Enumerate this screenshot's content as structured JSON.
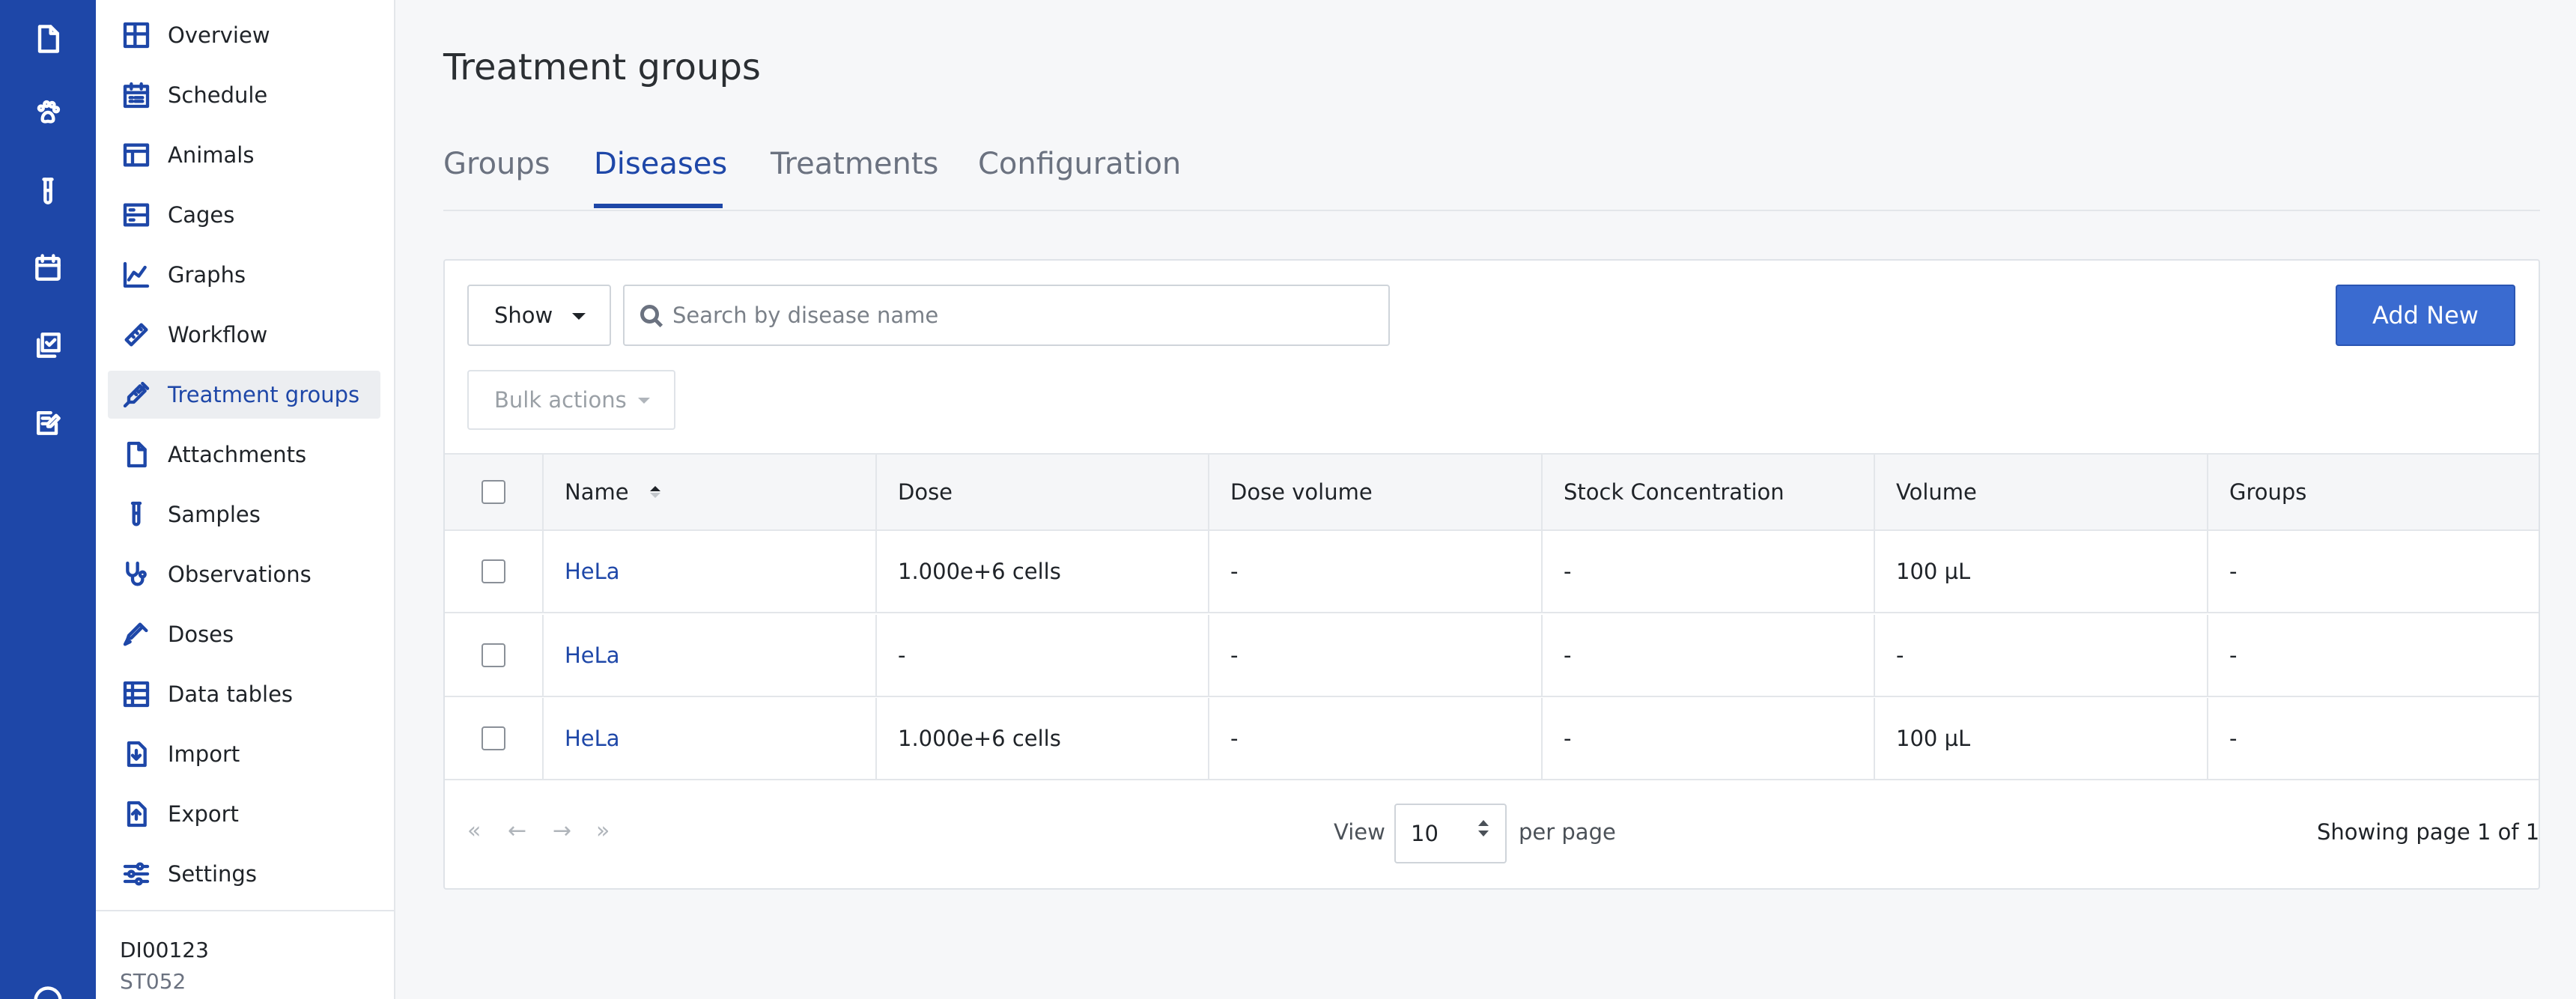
{
  "sidebar": {
    "items": [
      {
        "label": "Overview",
        "icon": "overview-icon"
      },
      {
        "label": "Schedule",
        "icon": "schedule-icon"
      },
      {
        "label": "Animals",
        "icon": "animals-icon"
      },
      {
        "label": "Cages",
        "icon": "cages-icon"
      },
      {
        "label": "Graphs",
        "icon": "graphs-icon"
      },
      {
        "label": "Workflow",
        "icon": "workflow-icon"
      },
      {
        "label": "Treatment groups",
        "icon": "syringe-icon",
        "active": true
      },
      {
        "label": "Attachments",
        "icon": "file-icon"
      },
      {
        "label": "Samples",
        "icon": "test-tube-icon"
      },
      {
        "label": "Observations",
        "icon": "stethoscope-icon"
      },
      {
        "label": "Doses",
        "icon": "dropper-icon"
      },
      {
        "label": "Data tables",
        "icon": "table-icon"
      },
      {
        "label": "Import",
        "icon": "import-icon"
      },
      {
        "label": "Export",
        "icon": "export-icon"
      },
      {
        "label": "Settings",
        "icon": "sliders-icon"
      }
    ],
    "study_id": "DI00123",
    "study_sub": "ST052"
  },
  "rail": {
    "icons": [
      "document-icon",
      "paw-icon",
      "test-tube-icon",
      "calendar-icon",
      "copy-check-icon",
      "task-edit-icon",
      "help-icon"
    ]
  },
  "page": {
    "title": "Treatment groups",
    "tabs": [
      {
        "label": "Groups"
      },
      {
        "label": "Diseases",
        "active": true
      },
      {
        "label": "Treatments"
      },
      {
        "label": "Configuration"
      }
    ]
  },
  "toolbar": {
    "show_label": "Show",
    "search_placeholder": "Search by disease name",
    "search_value": "",
    "add_label": "Add New",
    "bulk_label": "Bulk actions"
  },
  "table": {
    "headers": [
      "Name",
      "Dose",
      "Dose volume",
      "Stock Concentration",
      "Volume",
      "Groups"
    ],
    "rows": [
      [
        "HeLa",
        "1.000e+6 cells",
        "-",
        "-",
        "100 µL",
        "-"
      ],
      [
        "HeLa",
        "-",
        "-",
        "-",
        "-",
        "-"
      ],
      [
        "HeLa",
        "1.000e+6 cells",
        "-",
        "-",
        "100 µL",
        "-"
      ]
    ]
  },
  "pagination": {
    "first": "«",
    "prev": "←",
    "next": "→",
    "last": "»",
    "view_label": "View",
    "per_page": "10",
    "per_page_label": "per page",
    "page_info": "Showing page 1 of 1"
  },
  "colors": {
    "brand": "#1e47a8",
    "button": "#3a6bd0"
  }
}
